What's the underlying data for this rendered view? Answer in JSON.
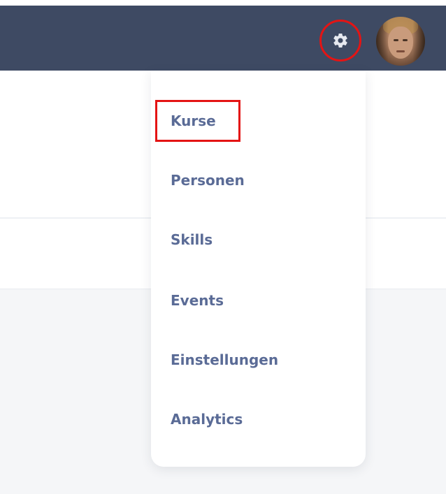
{
  "header": {
    "background_color": "#3e4a63",
    "settings_icon": "gear-icon",
    "highlight_color": "#e41414",
    "avatar": "user-avatar-photo"
  },
  "dropdown": {
    "items": [
      {
        "label": "Kurse",
        "highlighted": true
      },
      {
        "label": "Personen",
        "highlighted": false
      },
      {
        "label": "Skills",
        "highlighted": false
      },
      {
        "label": "Events",
        "highlighted": false
      },
      {
        "label": "Einstellungen",
        "highlighted": false
      },
      {
        "label": "Analytics",
        "highlighted": false
      }
    ],
    "text_color": "#5a6b96"
  }
}
